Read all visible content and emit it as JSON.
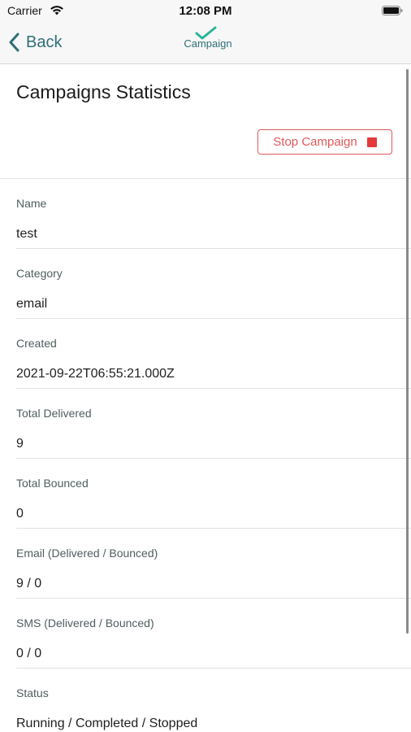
{
  "status_bar": {
    "carrier": "Carrier",
    "time": "12:08 PM",
    "icons": [
      "wifi-icon",
      "battery-icon"
    ]
  },
  "nav": {
    "back_label": "Back",
    "logo_text": "Campaign",
    "accent_color": "#2f6f78",
    "logo_check_color": "#2bb59a"
  },
  "page": {
    "title": "Campaigns Statistics",
    "stop_button_label": "Stop Campaign",
    "stop_color": "#e0585a"
  },
  "fields": [
    {
      "label": "Name",
      "value": "test"
    },
    {
      "label": "Category",
      "value": "email"
    },
    {
      "label": "Created",
      "value": "2021-09-22T06:55:21.000Z"
    },
    {
      "label": "Total Delivered",
      "value": "9"
    },
    {
      "label": "Total Bounced",
      "value": "0"
    },
    {
      "label": "Email (Delivered / Bounced)",
      "value": "9 / 0"
    },
    {
      "label": "SMS (Delivered / Bounced)",
      "value": "0 / 0"
    },
    {
      "label": "Status",
      "value": "Running / Completed / Stopped"
    }
  ]
}
